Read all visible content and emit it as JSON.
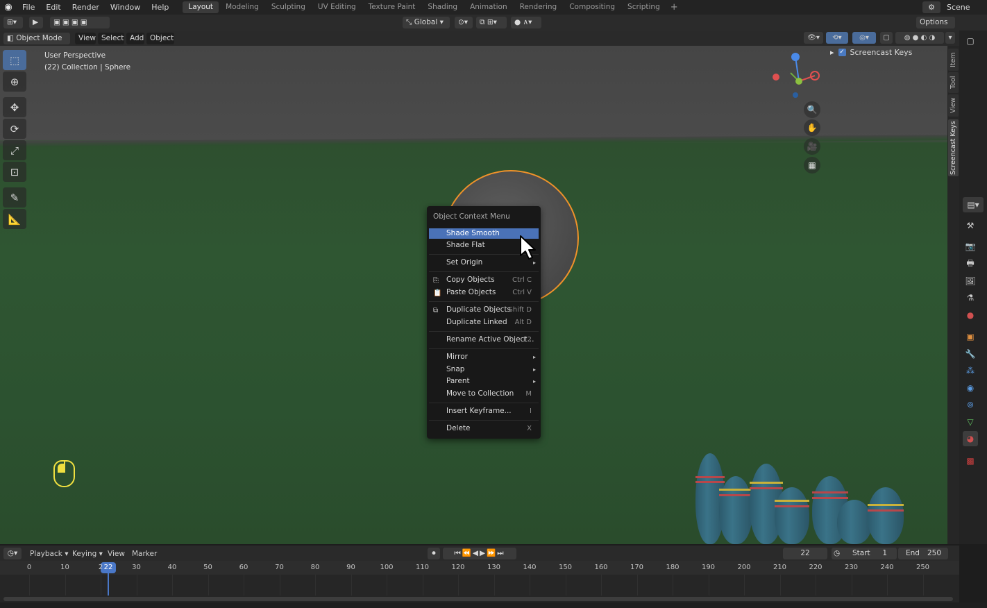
{
  "menubar": {
    "items": [
      "File",
      "Edit",
      "Render",
      "Window",
      "Help"
    ],
    "workspaces": [
      "Layout",
      "Modeling",
      "Sculpting",
      "UV Editing",
      "Texture Paint",
      "Shading",
      "Animation",
      "Rendering",
      "Compositing",
      "Scripting"
    ],
    "active_workspace": "Layout",
    "add_tab": "+",
    "scene": "Scene"
  },
  "toolheader": {
    "orientation": "Global",
    "options": "Options"
  },
  "viewport_header": {
    "mode": "Object Mode",
    "menus": [
      "View",
      "Select",
      "Add",
      "Object"
    ]
  },
  "viewport": {
    "perspective": "User Perspective",
    "collection": "(22) Collection | Sphere"
  },
  "sidebar": {
    "tabs": [
      "Item",
      "Tool",
      "View",
      "Screencast Keys"
    ],
    "active_tab": "Screencast Keys",
    "item": "Screencast Keys",
    "checkbox": "✓"
  },
  "context_menu": {
    "title": "Object Context Menu",
    "items": [
      {
        "label": "Shade Smooth",
        "shortcut": "",
        "submenu": false
      },
      {
        "label": "Shade Flat",
        "shortcut": "",
        "submenu": false
      },
      {
        "label": "Set Origin",
        "shortcut": "",
        "submenu": true
      },
      {
        "label": "Copy Objects",
        "shortcut": "Ctrl C",
        "submenu": false
      },
      {
        "label": "Paste Objects",
        "shortcut": "Ctrl V",
        "submenu": false
      },
      {
        "label": "Duplicate Objects",
        "shortcut": "Shift D",
        "submenu": false
      },
      {
        "label": "Duplicate Linked",
        "shortcut": "Alt D",
        "submenu": false
      },
      {
        "label": "Rename Active Object...",
        "shortcut": "F2",
        "submenu": false
      },
      {
        "label": "Mirror",
        "shortcut": "",
        "submenu": true
      },
      {
        "label": "Snap",
        "shortcut": "",
        "submenu": true
      },
      {
        "label": "Parent",
        "shortcut": "",
        "submenu": true
      },
      {
        "label": "Move to Collection",
        "shortcut": "M",
        "submenu": false
      },
      {
        "label": "Insert Keyframe...",
        "shortcut": "I",
        "submenu": false
      },
      {
        "label": "Delete",
        "shortcut": "X",
        "submenu": false
      }
    ]
  },
  "timeline": {
    "menus": [
      "Playback",
      "Keying",
      "View",
      "Marker"
    ],
    "current_frame": "22",
    "start_label": "Start",
    "start": "1",
    "end_label": "End",
    "end": "250",
    "ticks": [
      "0",
      "10",
      "2",
      "30",
      "40",
      "50",
      "60",
      "70",
      "80",
      "90",
      "100",
      "110",
      "120",
      "130",
      "140",
      "150",
      "160",
      "170",
      "180",
      "190",
      "200",
      "210",
      "220",
      "230",
      "240",
      "250"
    ]
  },
  "colors": {
    "accent": "#4a72b8",
    "selection_outline": "#f0922a",
    "mouse_indicator": "#f0e040",
    "floor": "#2f5632"
  }
}
